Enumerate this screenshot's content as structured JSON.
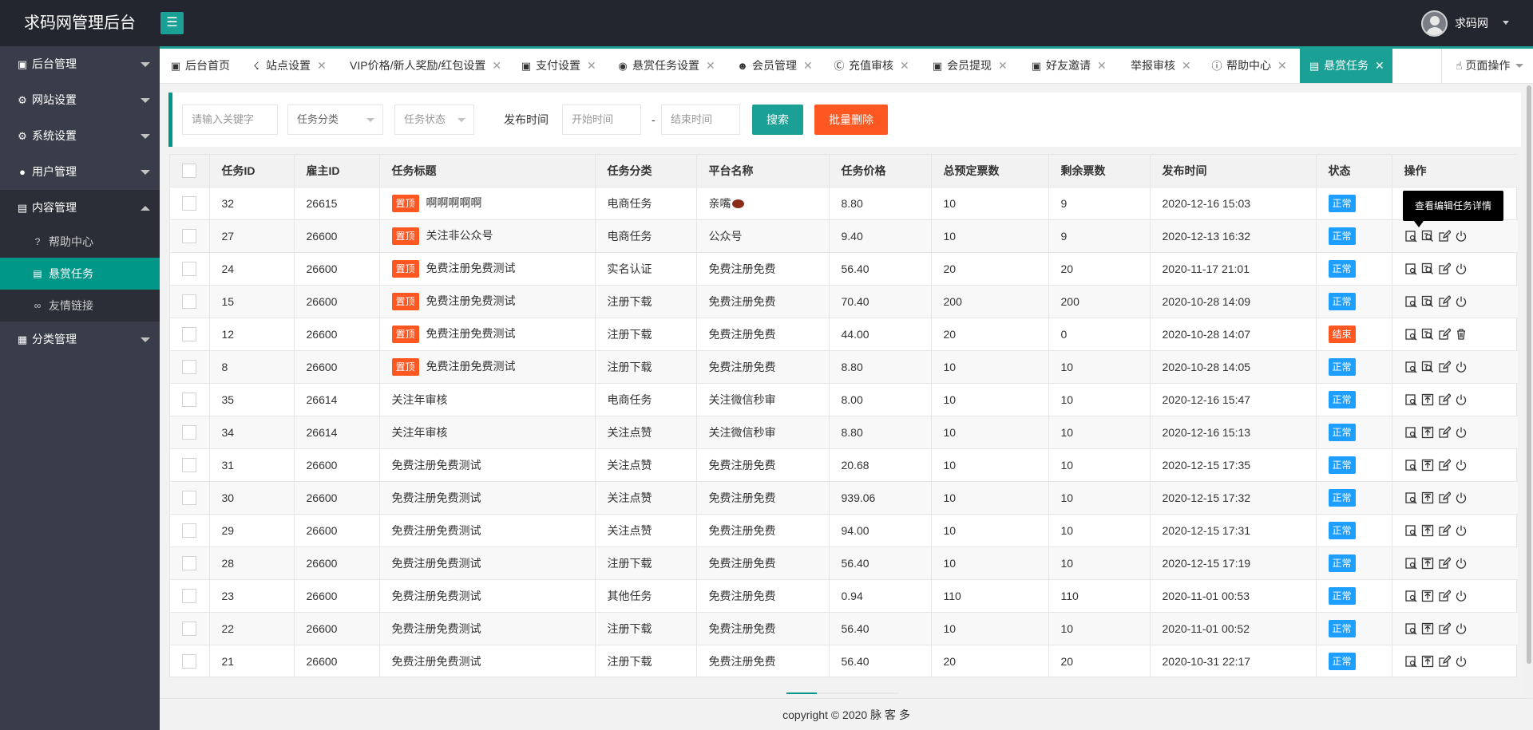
{
  "app": {
    "title": "求码网管理后台",
    "user": "求码网"
  },
  "sidebar": {
    "items": [
      {
        "label": "后台管理",
        "icon": "monitor-icon"
      },
      {
        "label": "网站设置",
        "icon": "gears-icon"
      },
      {
        "label": "系统设置",
        "icon": "gear-icon"
      },
      {
        "label": "用户管理",
        "icon": "user-icon"
      },
      {
        "label": "内容管理",
        "icon": "document-icon"
      },
      {
        "label": "分类管理",
        "icon": "grid-icon"
      }
    ],
    "subitems": [
      {
        "label": "帮助中心",
        "icon": "question-icon"
      },
      {
        "label": "悬赏任务",
        "icon": "document-icon"
      },
      {
        "label": "友情链接",
        "icon": "link-icon"
      }
    ]
  },
  "tabs": [
    {
      "label": "后台首页"
    },
    {
      "label": "站点设置"
    },
    {
      "label": "VIP价格/新人奖励/红包设置"
    },
    {
      "label": "支付设置"
    },
    {
      "label": "悬赏任务设置"
    },
    {
      "label": "会员管理"
    },
    {
      "label": "充值审核"
    },
    {
      "label": "会员提现"
    },
    {
      "label": "好友邀请"
    },
    {
      "label": "举报审核"
    },
    {
      "label": "帮助中心"
    },
    {
      "label": "悬赏任务"
    }
  ],
  "page_op": "页面操作",
  "search": {
    "keyword_placeholder": "请输入关键字",
    "category": "任务分类",
    "status": "任务状态",
    "time_label": "发布时间",
    "start_placeholder": "开始时间",
    "dash": "-",
    "end_placeholder": "结束时间",
    "search_btn": "搜索",
    "delete_btn": "批量删除"
  },
  "table": {
    "headers": [
      "任务ID",
      "雇主ID",
      "任务标题",
      "任务分类",
      "平台名称",
      "任务价格",
      "总预定票数",
      "剩余票数",
      "发布时间",
      "状态",
      "操作"
    ],
    "pin_label": "置顶",
    "rows": [
      {
        "id": "32",
        "employer": "26615",
        "pinned": true,
        "title": "啊啊啊啊啊",
        "category": "电商任务",
        "platform": "亲嘴",
        "price": "8.80",
        "total": "10",
        "remain": "9",
        "time": "2020-12-16 15:03",
        "status": "正常"
      },
      {
        "id": "27",
        "employer": "26600",
        "pinned": true,
        "title": "关注非公众号",
        "category": "电商任务",
        "platform": "公众号",
        "price": "9.40",
        "total": "10",
        "remain": "9",
        "time": "2020-12-13 16:32",
        "status": "正常"
      },
      {
        "id": "24",
        "employer": "26600",
        "pinned": true,
        "title": "免费注册免费测试",
        "category": "实名认证",
        "platform": "免费注册免费",
        "price": "56.40",
        "total": "20",
        "remain": "20",
        "time": "2020-11-17 21:01",
        "status": "正常"
      },
      {
        "id": "15",
        "employer": "26600",
        "pinned": true,
        "title": "免费注册免费测试",
        "category": "注册下载",
        "platform": "免费注册免费",
        "price": "70.40",
        "total": "200",
        "remain": "200",
        "time": "2020-10-28 14:09",
        "status": "正常"
      },
      {
        "id": "12",
        "employer": "26600",
        "pinned": true,
        "title": "免费注册免费测试",
        "category": "注册下载",
        "platform": "免费注册免费",
        "price": "44.00",
        "total": "20",
        "remain": "0",
        "time": "2020-10-28 14:07",
        "status": "结束"
      },
      {
        "id": "8",
        "employer": "26600",
        "pinned": true,
        "title": "免费注册免费测试",
        "category": "注册下载",
        "platform": "免费注册免费",
        "price": "8.80",
        "total": "10",
        "remain": "10",
        "time": "2020-10-28 14:05",
        "status": "正常"
      },
      {
        "id": "35",
        "employer": "26614",
        "pinned": false,
        "title": "关注年审核",
        "category": "电商任务",
        "platform": "关注微信秒审",
        "price": "8.00",
        "total": "10",
        "remain": "10",
        "time": "2020-12-16 15:47",
        "status": "正常"
      },
      {
        "id": "34",
        "employer": "26614",
        "pinned": false,
        "title": "关注年审核",
        "category": "关注点赞",
        "platform": "关注微信秒审",
        "price": "8.80",
        "total": "10",
        "remain": "10",
        "time": "2020-12-16 15:13",
        "status": "正常"
      },
      {
        "id": "31",
        "employer": "26600",
        "pinned": false,
        "title": "免费注册免费测试",
        "category": "关注点赞",
        "platform": "免费注册免费",
        "price": "20.68",
        "total": "10",
        "remain": "10",
        "time": "2020-12-15 17:35",
        "status": "正常"
      },
      {
        "id": "30",
        "employer": "26600",
        "pinned": false,
        "title": "免费注册免费测试",
        "category": "关注点赞",
        "platform": "免费注册免费",
        "price": "939.06",
        "total": "10",
        "remain": "10",
        "time": "2020-12-15 17:32",
        "status": "正常"
      },
      {
        "id": "29",
        "employer": "26600",
        "pinned": false,
        "title": "免费注册免费测试",
        "category": "关注点赞",
        "platform": "免费注册免费",
        "price": "94.00",
        "total": "10",
        "remain": "10",
        "time": "2020-12-15 17:31",
        "status": "正常"
      },
      {
        "id": "28",
        "employer": "26600",
        "pinned": false,
        "title": "免费注册免费测试",
        "category": "注册下载",
        "platform": "免费注册免费",
        "price": "56.40",
        "total": "10",
        "remain": "10",
        "time": "2020-12-15 17:19",
        "status": "正常"
      },
      {
        "id": "23",
        "employer": "26600",
        "pinned": false,
        "title": "免费注册免费测试",
        "category": "其他任务",
        "platform": "免费注册免费",
        "price": "0.94",
        "total": "110",
        "remain": "110",
        "time": "2020-11-01 00:53",
        "status": "正常"
      },
      {
        "id": "22",
        "employer": "26600",
        "pinned": false,
        "title": "免费注册免费测试",
        "category": "注册下载",
        "platform": "免费注册免费",
        "price": "56.40",
        "total": "10",
        "remain": "10",
        "time": "2020-11-01 00:52",
        "status": "正常"
      },
      {
        "id": "21",
        "employer": "26600",
        "pinned": false,
        "title": "免费注册免费测试",
        "category": "注册下载",
        "platform": "免费注册免费",
        "price": "56.40",
        "total": "20",
        "remain": "20",
        "time": "2020-10-31 22:17",
        "status": "正常"
      }
    ]
  },
  "tooltip": "查看编辑任务详情",
  "footer": "copyright © 2020 脉 客 多",
  "colors": {
    "accent": "#009688",
    "header": "#23262e",
    "sidebar": "#393d49",
    "danger": "#ff5722",
    "info": "#1e9fff"
  }
}
